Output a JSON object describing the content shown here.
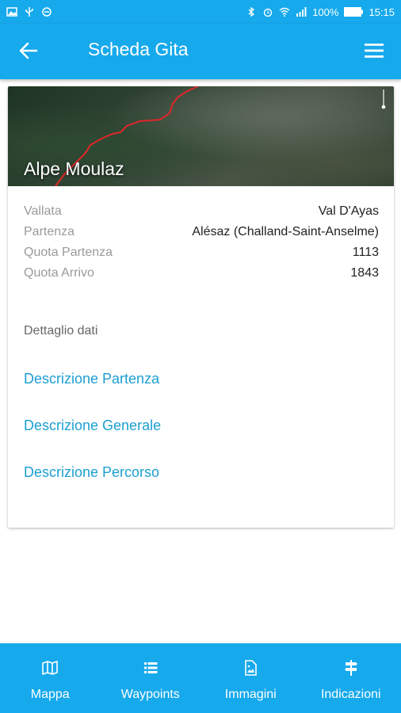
{
  "status_bar": {
    "battery": "100%",
    "time": "15:15"
  },
  "app_bar": {
    "title": "Scheda Gita",
    "back_icon": "arrow-back-icon",
    "menu_icon": "hamburger-menu-icon"
  },
  "hike": {
    "name": "Alpe Moulaz",
    "info": [
      {
        "label": "Vallata",
        "value": "Val D'Ayas"
      },
      {
        "label": "Partenza",
        "value": "Alésaz (Challand-Saint-Anselme)"
      },
      {
        "label": "Quota Partenza",
        "value": "1113"
      },
      {
        "label": "Quota Arrivo",
        "value": "1843"
      }
    ],
    "details_label": "Dettaglio dati",
    "links": [
      "Descrizione Partenza",
      "Descrizione Generale",
      "Descrizione Percorso"
    ]
  },
  "bottom_nav": [
    {
      "label": "Mappa",
      "icon": "map-icon"
    },
    {
      "label": "Waypoints",
      "icon": "list-icon"
    },
    {
      "label": "Immagini",
      "icon": "image-icon"
    },
    {
      "label": "Indicazioni",
      "icon": "signpost-icon"
    }
  ],
  "colors": {
    "primary": "#16a9ec",
    "link": "#1c9fd2",
    "route": "#e0262a"
  }
}
